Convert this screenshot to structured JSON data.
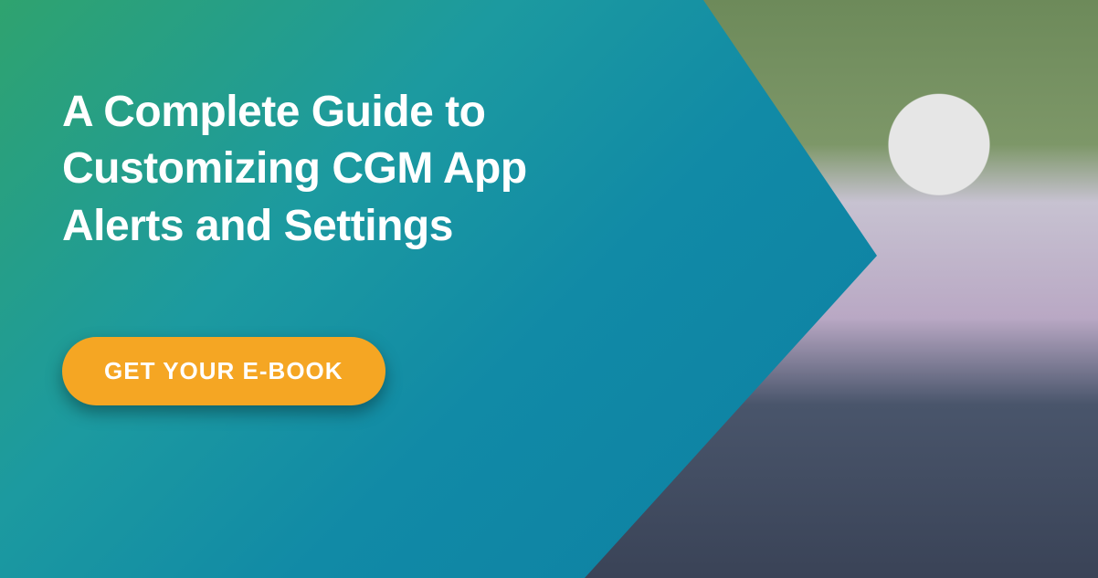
{
  "banner": {
    "headline": "A Complete Guide to Customizing CGM App Alerts and Settings",
    "cta_label": "GET YOUR E-BOOK",
    "image_alt": "Smiling older couple outdoors looking at a smartphone together",
    "colors": {
      "gradient_start": "#2fa36f",
      "gradient_end": "#0d7fa3",
      "cta_bg": "#f5a623",
      "text": "#ffffff"
    }
  }
}
